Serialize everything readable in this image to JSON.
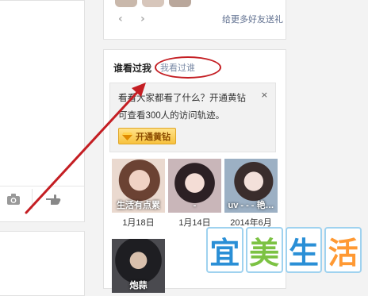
{
  "gift_panel": {
    "prev_arrow": "‹",
    "next_arrow": "›",
    "link": "给更多好友送礼"
  },
  "visitors_panel": {
    "title": "谁看过我",
    "tab_i_viewed": "我看过谁",
    "promo": {
      "line1": "看看大家都看了什么？开通黄钻",
      "line2": "可查看300人的访问轨迹。",
      "button": "开通黄钻",
      "close": "×"
    },
    "visitors": [
      {
        "name": "生活有点累",
        "date": "1月18日"
      },
      {
        "name": "-",
        "date": "1月14日"
      },
      {
        "name": "uv - - - 艳…",
        "date": "2014年6月"
      },
      {
        "name": "炮蒜",
        "date": ""
      }
    ]
  },
  "watermark": {
    "chars": [
      "宜",
      "美",
      "生",
      "活"
    ],
    "colors": [
      "#2a8fd6",
      "#7cc243",
      "#2a8fd6",
      "#ff9933"
    ]
  },
  "colors": {
    "annotation_red": "#c41e23",
    "link_blue": "#5f6f8f",
    "vip_gold": "#f7c23e"
  }
}
